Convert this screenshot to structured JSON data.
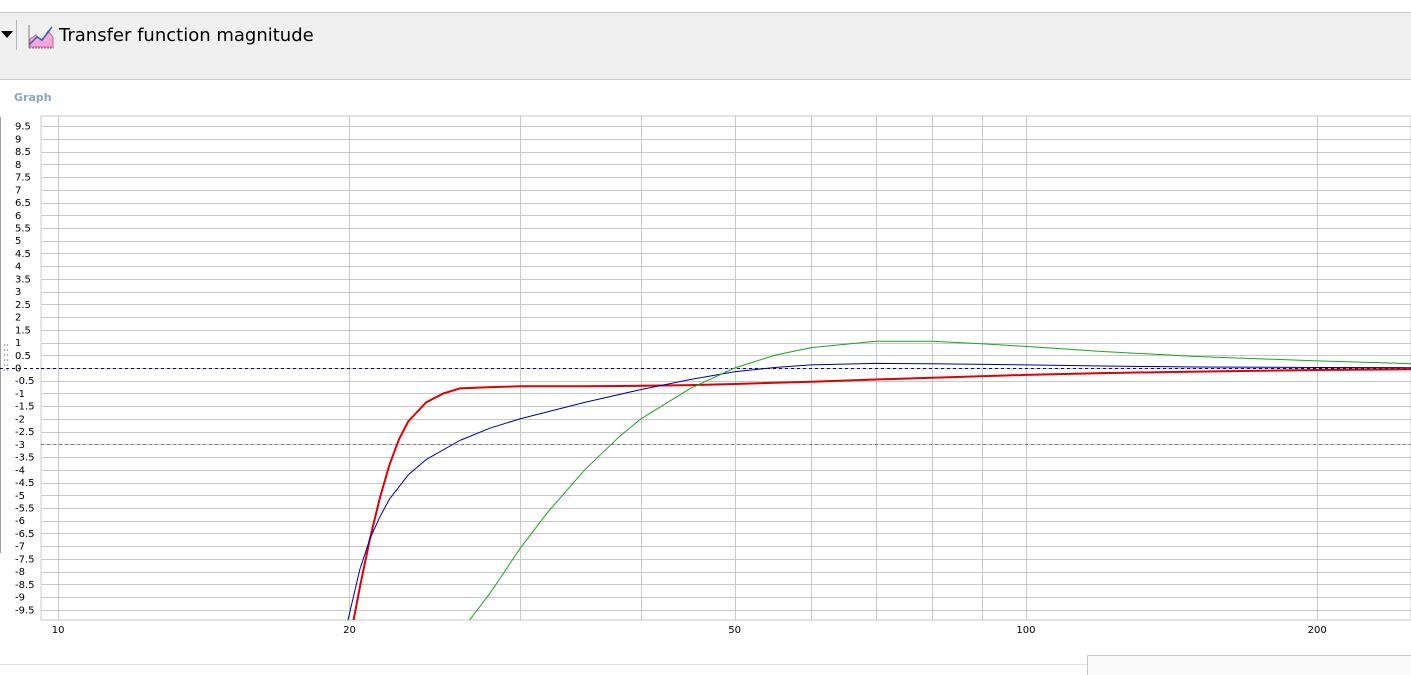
{
  "header": {
    "title": "Transfer function magnitude",
    "icon": "chart-line-icon"
  },
  "section": {
    "label": "Graph"
  },
  "colors": {
    "header_bg": "#f0f0f0",
    "grid": "#c8c8c8",
    "series_red": "#e00000",
    "series_blue": "#0000a0",
    "series_green": "#20a020",
    "ref_line_zero": "#00008b",
    "ref_line_minus3": "#808080"
  },
  "chart_data": {
    "type": "line",
    "title": "Transfer function magnitude",
    "xlabel": "",
    "ylabel": "",
    "x_scale": "log",
    "xlim": [
      9.6,
      250
    ],
    "ylim": [
      -9.9,
      9.9
    ],
    "grid": true,
    "x_ticks": [
      10,
      20,
      50,
      100,
      200
    ],
    "x_tick_labels": [
      "10",
      "20",
      "50",
      "100",
      "200"
    ],
    "x_minor_grid": [
      30,
      40,
      60,
      70,
      80,
      90
    ],
    "y_ticks": [
      9.5,
      9,
      8.5,
      8,
      7.5,
      7,
      6.5,
      6,
      5.5,
      5,
      4.5,
      4,
      3.5,
      3,
      2.5,
      2,
      1.5,
      1,
      0.5,
      0,
      -0.5,
      -1,
      -1.5,
      -2,
      -2.5,
      -3,
      -3.5,
      -4,
      -4.5,
      -5,
      -5.5,
      -6,
      -6.5,
      -7,
      -7.5,
      -8,
      -8.5,
      -9,
      -9.5
    ],
    "y_tick_labels": [
      "9.5",
      "9",
      "8.5",
      "8",
      "7.5",
      "7",
      "6.5",
      "6",
      "5.5",
      "5",
      "4.5",
      "4",
      "3.5",
      "3",
      "2.5",
      "2",
      "1.5",
      "1",
      "0.5",
      "0",
      "-0.5",
      "-1",
      "-1.5",
      "-2",
      "-2.5",
      "-3",
      "-3.5",
      "-4",
      "-4.5",
      "-5",
      "-5.5",
      "-6",
      "-6.5",
      "-7",
      "-7.5",
      "-8",
      "-8.5",
      "-9",
      "-9.5"
    ],
    "reference_lines": [
      {
        "y": 0,
        "style": "dashed",
        "color": "#00008b"
      },
      {
        "y": -3,
        "style": "dashed",
        "color": "#808080"
      }
    ],
    "series": [
      {
        "color": "#e00000",
        "width": 2,
        "x": [
          20.1,
          20.5,
          21,
          21.5,
          22,
          22.5,
          23,
          24,
          25,
          26,
          28,
          30,
          35,
          40,
          45,
          50,
          60,
          70,
          80,
          100,
          120,
          150,
          200,
          250
        ],
        "y": [
          -10.3,
          -8.6,
          -6.7,
          -5.1,
          -3.8,
          -2.8,
          -2.1,
          -1.35,
          -1.0,
          -0.8,
          -0.75,
          -0.72,
          -0.72,
          -0.7,
          -0.67,
          -0.63,
          -0.54,
          -0.45,
          -0.38,
          -0.27,
          -0.2,
          -0.14,
          -0.08,
          -0.05
        ]
      },
      {
        "color": "#0000a0",
        "width": 1,
        "x": [
          19.9,
          20.5,
          21,
          21.5,
          22,
          23,
          24,
          26,
          28,
          30,
          35,
          40,
          45,
          50,
          55,
          60,
          70,
          80,
          100,
          120,
          150,
          200,
          250
        ],
        "y": [
          -10.0,
          -7.9,
          -6.7,
          -5.85,
          -5.15,
          -4.2,
          -3.6,
          -2.85,
          -2.35,
          -2.0,
          -1.35,
          -0.85,
          -0.45,
          -0.15,
          0.02,
          0.12,
          0.18,
          0.17,
          0.12,
          0.08,
          0.04,
          0.02,
          0.01
        ]
      },
      {
        "color": "#20a020",
        "width": 1,
        "x": [
          26.5,
          28,
          30,
          32,
          35,
          38,
          40,
          45,
          50,
          55,
          60,
          70,
          80,
          90,
          100,
          120,
          150,
          200,
          250
        ],
        "y": [
          -10.0,
          -8.8,
          -7.1,
          -5.7,
          -4.0,
          -2.7,
          -2.0,
          -0.8,
          0.0,
          0.5,
          0.8,
          1.05,
          1.05,
          0.95,
          0.85,
          0.65,
          0.45,
          0.28,
          0.17
        ]
      }
    ]
  }
}
